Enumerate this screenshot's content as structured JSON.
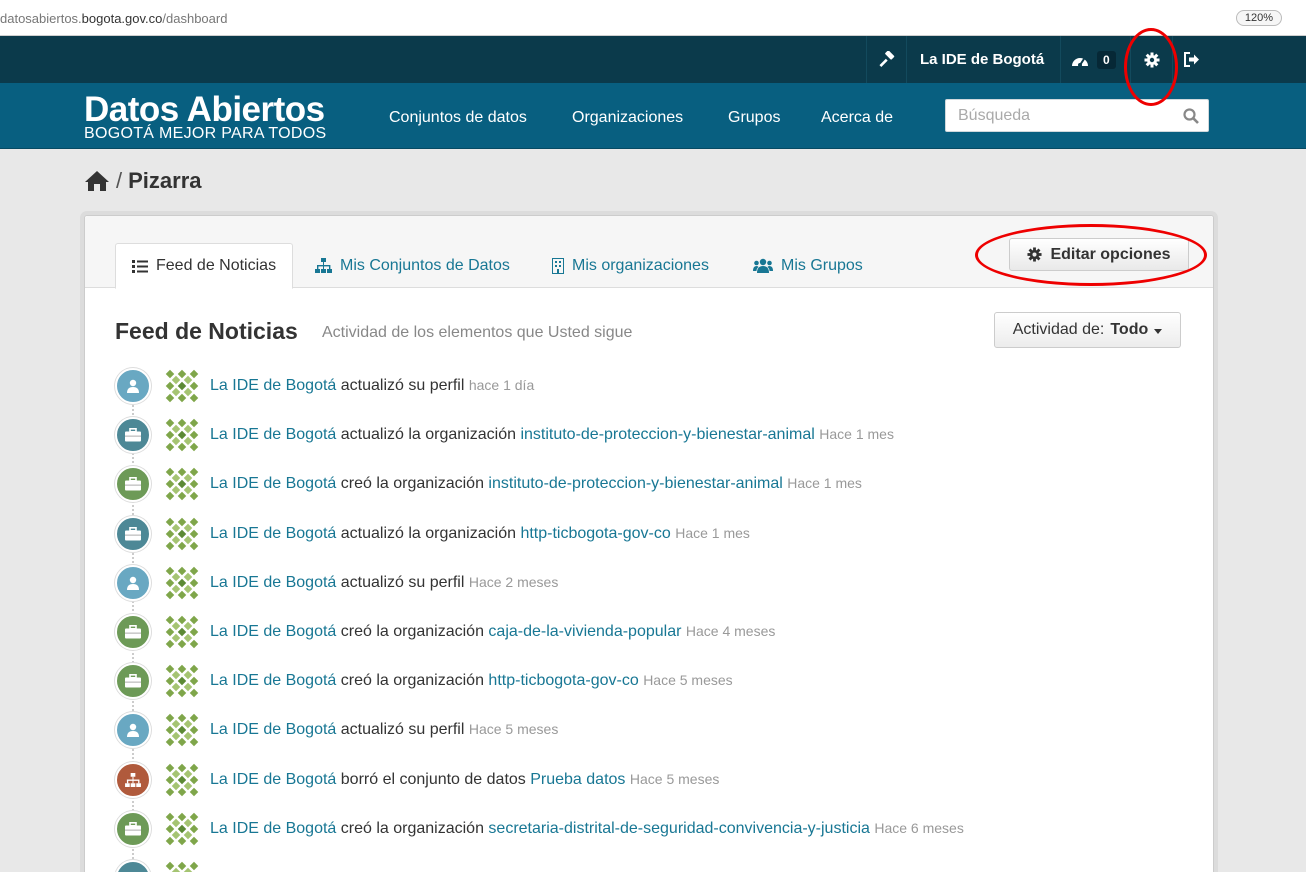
{
  "address_bar": {
    "url_prefix": "datosabiertos.",
    "url_domain": "bogota.gov.co",
    "url_path": "/dashboard",
    "zoom": "120%"
  },
  "account": {
    "user_name": "La IDE de Bogotá",
    "dashboard_count": "0"
  },
  "masthead": {
    "logo_title": "Datos Abiertos",
    "logo_subtitle": "BOGOTÁ MEJOR PARA TODOS",
    "nav": [
      "Conjuntos de datos",
      "Organizaciones",
      "Grupos",
      "Acerca de"
    ],
    "search_placeholder": "Búsqueda"
  },
  "breadcrumb": {
    "current": "Pizarra",
    "separator": "/"
  },
  "tabs": [
    {
      "label": "Feed de Noticias",
      "icon": "list-icon",
      "active": true
    },
    {
      "label": "Mis Conjuntos de Datos",
      "icon": "sitemap-icon",
      "active": false
    },
    {
      "label": "Mis organizaciones",
      "icon": "building-icon",
      "active": false
    },
    {
      "label": "Mis Grupos",
      "icon": "group-icon",
      "active": false
    }
  ],
  "edit_button": "Editar opciones",
  "feed": {
    "title": "Feed de Noticias",
    "subtitle": "Actividad de los elementos que Usted sigue",
    "filter_label": "Actividad de:",
    "filter_value": "Todo",
    "items": [
      {
        "icon": "user-icon",
        "color": "#69a8c2",
        "actor": "La IDE de Bogotá",
        "action": "actualizó su perfil",
        "object": "",
        "date": "hace 1 día"
      },
      {
        "icon": "briefcase-icon",
        "color": "#4d8896",
        "actor": "La IDE de Bogotá",
        "action": "actualizó la organización",
        "object": "instituto-de-proteccion-y-bienestar-animal",
        "date": "Hace 1 mes"
      },
      {
        "icon": "briefcase-icon",
        "color": "#6d9a57",
        "actor": "La IDE de Bogotá",
        "action": "creó la organización",
        "object": "instituto-de-proteccion-y-bienestar-animal",
        "date": "Hace 1 mes"
      },
      {
        "icon": "briefcase-icon",
        "color": "#4d8896",
        "actor": "La IDE de Bogotá",
        "action": "actualizó la organización",
        "object": "http-ticbogota-gov-co",
        "date": "Hace 1 mes"
      },
      {
        "icon": "user-icon",
        "color": "#69a8c2",
        "actor": "La IDE de Bogotá",
        "action": "actualizó su perfil",
        "object": "",
        "date": "Hace 2 meses"
      },
      {
        "icon": "briefcase-icon",
        "color": "#6d9a57",
        "actor": "La IDE de Bogotá",
        "action": "creó la organización",
        "object": "caja-de-la-vivienda-popular",
        "date": "Hace 4 meses"
      },
      {
        "icon": "briefcase-icon",
        "color": "#6d9a57",
        "actor": "La IDE de Bogotá",
        "action": "creó la organización",
        "object": "http-ticbogota-gov-co",
        "date": "Hace 5 meses"
      },
      {
        "icon": "user-icon",
        "color": "#69a8c2",
        "actor": "La IDE de Bogotá",
        "action": "actualizó su perfil",
        "object": "",
        "date": "Hace 5 meses"
      },
      {
        "icon": "sitemap-icon",
        "color": "#b05a3c",
        "actor": "La IDE de Bogotá",
        "action": "borró el conjunto de datos",
        "object": "Prueba datos",
        "date": "Hace 5 meses"
      },
      {
        "icon": "briefcase-icon",
        "color": "#6d9a57",
        "actor": "La IDE de Bogotá",
        "action": "creó la organización",
        "object": "secretaria-distrital-de-seguridad-convivencia-y-justicia",
        "date": "Hace 6 meses"
      }
    ]
  }
}
